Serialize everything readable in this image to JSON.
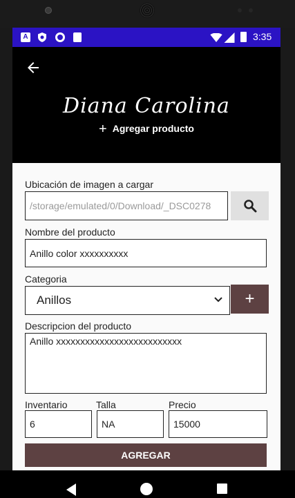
{
  "status_bar": {
    "time": "3:35",
    "icons": [
      "a-notification-icon",
      "shield-icon",
      "circle-icon",
      "sd-card-icon",
      "wifi-icon",
      "signal-icon",
      "battery-icon"
    ]
  },
  "header": {
    "brand": "Diana Carolina",
    "subtitle": "Agregar producto"
  },
  "form": {
    "image_label": "Ubicación de imagen a cargar",
    "image_value": "/storage/emulated/0/Download/_DSC0278",
    "name_label": "Nombre del producto",
    "name_value": "Anillo color xxxxxxxxxx",
    "category_label": "Categoria",
    "category_value": "Anillos",
    "description_label": "Descripcion del producto",
    "description_value": "Anillo xxxxxxxxxxxxxxxxxxxxxxxxxx",
    "inventory_label": "Inventario",
    "inventory_value": "6",
    "size_label": "Talla",
    "size_value": "NA",
    "price_label": "Precio",
    "price_value": "15000",
    "submit_label": "AGREGAR"
  },
  "colors": {
    "status_bar": "#2b13c4",
    "header_bg": "#000000",
    "accent": "#5d4142"
  }
}
